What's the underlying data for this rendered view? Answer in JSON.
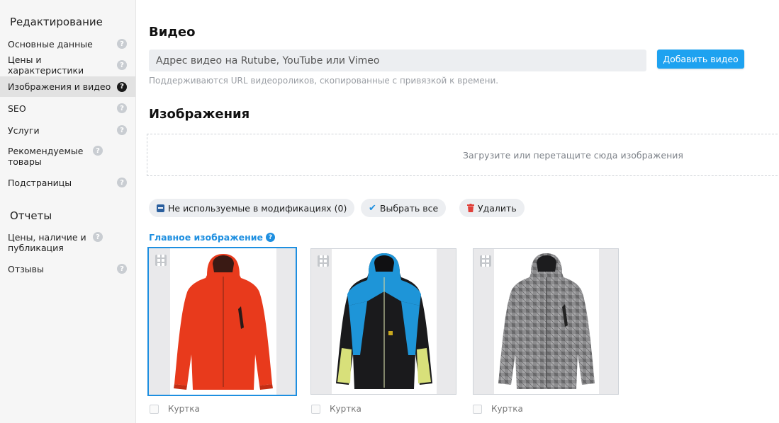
{
  "sidebar": {
    "heading_edit": "Редактирование",
    "items": [
      {
        "label": "Основные данные"
      },
      {
        "label": "Цены и характеристики"
      },
      {
        "label": "Изображения и видео"
      },
      {
        "label": "SEO"
      },
      {
        "label": "Услуги"
      },
      {
        "label": "Рекомендуемые товары"
      },
      {
        "label": "Подстраницы"
      }
    ],
    "heading_reports": "Отчеты",
    "report_items": [
      {
        "label": "Цены, наличие и публикация"
      },
      {
        "label": "Отзывы"
      }
    ],
    "help_icon_glyph": "?"
  },
  "video": {
    "title": "Видео",
    "input_placeholder": "Адрес видео на Rutube, YouTube или Vimeo",
    "add_button": "Добавить видео",
    "hint": "Поддерживаются URL видеороликов, скопированные с привязкой к времени."
  },
  "images": {
    "title": "Изображения",
    "dropzone_text": "Загрузите или перетащите сюда изображения",
    "actions": {
      "unused": "Не используемые в модификациях (0)",
      "select_all": "Выбрать все",
      "delete": "Удалить"
    },
    "main_image_label": "Главное изображение",
    "cards": [
      {
        "caption": "Куртка",
        "jacket": "red",
        "selected": true
      },
      {
        "caption": "Куртка",
        "jacket": "blue-black",
        "selected": false
      },
      {
        "caption": "Куртка",
        "jacket": "grey-plaid",
        "selected": false
      }
    ]
  },
  "colors": {
    "accent": "#1e8fe0",
    "button": "#1ea2f0",
    "delete": "#e0403a"
  }
}
